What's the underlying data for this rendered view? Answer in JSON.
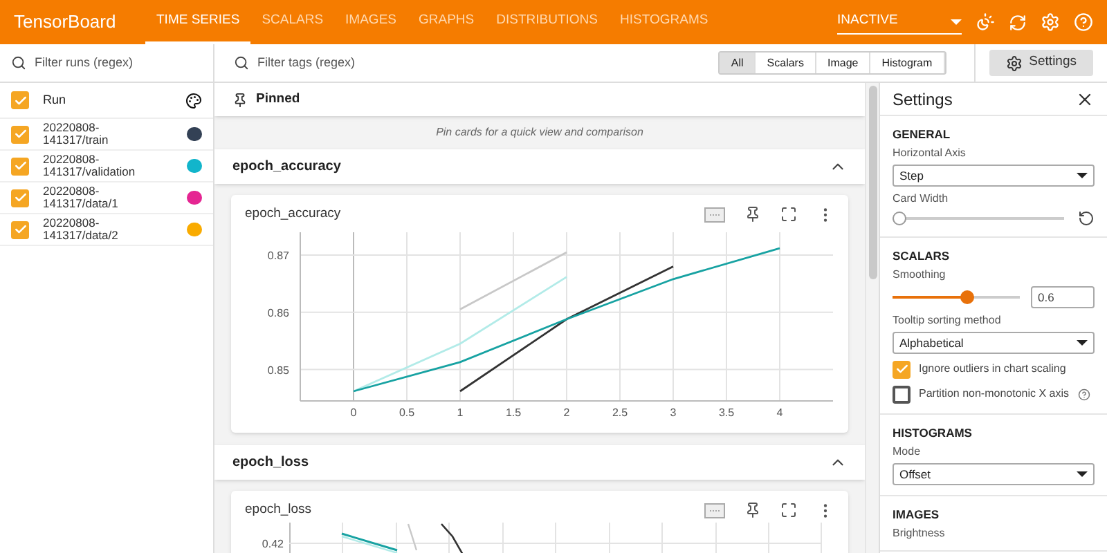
{
  "app": {
    "title": "TensorBoard"
  },
  "nav_tabs": [
    {
      "label": "TIME SERIES",
      "selected": true
    },
    {
      "label": "SCALARS",
      "selected": false
    },
    {
      "label": "IMAGES",
      "selected": false
    },
    {
      "label": "GRAPHS",
      "selected": false
    },
    {
      "label": "DISTRIBUTIONS",
      "selected": false
    },
    {
      "label": "HISTOGRAMS",
      "selected": false
    }
  ],
  "status_dropdown": {
    "value": "INACTIVE"
  },
  "runs_filter": {
    "placeholder": "Filter runs (regex)"
  },
  "runs": {
    "header": {
      "label": "Run",
      "checked": true
    },
    "items": [
      {
        "name": "20220808-141317/train",
        "checked": true,
        "color": "#334155"
      },
      {
        "name": "20220808-141317/validation",
        "checked": true,
        "color": "#12b5cb"
      },
      {
        "name": "20220808-141317/data/1",
        "checked": true,
        "color": "#e52592"
      },
      {
        "name": "20220808-141317/data/2",
        "checked": true,
        "color": "#f9ab00"
      }
    ]
  },
  "tags_filter": {
    "placeholder": "Filter tags (regex)"
  },
  "type_filters": [
    {
      "label": "All",
      "selected": true
    },
    {
      "label": "Scalars",
      "selected": false
    },
    {
      "label": "Image",
      "selected": false
    },
    {
      "label": "Histogram",
      "selected": false
    }
  ],
  "settings_button": {
    "label": "Settings"
  },
  "pinned": {
    "title": "Pinned",
    "empty_message": "Pin cards for a quick view and comparison"
  },
  "groups": [
    {
      "title": "epoch_accuracy",
      "expanded": true,
      "card": {
        "title": "epoch_accuracy",
        "chart_data": {
          "type": "line",
          "grid": true,
          "x": [
            0,
            1,
            2,
            3,
            4
          ],
          "xlim": [
            -0.5,
            4.5
          ],
          "ylim": [
            0.8445,
            0.874
          ],
          "xticks": [
            0,
            0.5,
            1,
            1.5,
            2,
            2.5,
            3,
            3.5,
            4
          ],
          "yticks": [
            0.85,
            0.86,
            0.87
          ],
          "series": [
            {
              "color": "#c8c8c8",
              "values": [
                null,
                0.8605,
                0.8705,
                null,
                null
              ]
            },
            {
              "color": "#b2ebe8",
              "values": [
                0.8462,
                0.8545,
                0.8662,
                null,
                null
              ]
            },
            {
              "color": "#333333",
              "values": [
                null,
                0.8462,
                0.8588,
                0.868,
                null
              ]
            },
            {
              "color": "#17a2a2",
              "values": [
                0.8462,
                0.8513,
                0.8588,
                0.8658,
                0.8712
              ]
            }
          ]
        }
      }
    },
    {
      "title": "epoch_loss",
      "expanded": true,
      "card": {
        "title": "epoch_loss",
        "visible_tick": "0.42"
      }
    }
  ],
  "settings": {
    "title": "Settings",
    "sections": [
      {
        "title": "GENERAL",
        "fields": [
          {
            "kind": "select",
            "label": "Horizontal Axis",
            "value": "Step"
          },
          {
            "kind": "slider",
            "label": "Card Width",
            "level": 0
          }
        ]
      },
      {
        "title": "SCALARS",
        "fields": [
          {
            "kind": "slider_input",
            "label": "Smoothing",
            "level": 0.6,
            "value": "0.6"
          },
          {
            "kind": "select",
            "label": "Tooltip sorting method",
            "value": "Alphabetical"
          },
          {
            "kind": "checkbox",
            "label": "Ignore outliers in chart scaling",
            "checked": true
          },
          {
            "kind": "checkbox",
            "label": "Partition non-monotonic X axis",
            "checked": false,
            "help": true
          }
        ]
      },
      {
        "title": "HISTOGRAMS",
        "fields": [
          {
            "kind": "select",
            "label": "Mode",
            "value": "Offset"
          }
        ]
      },
      {
        "title": "IMAGES",
        "fields": [
          {
            "kind": "label",
            "label": "Brightness"
          }
        ]
      }
    ]
  }
}
